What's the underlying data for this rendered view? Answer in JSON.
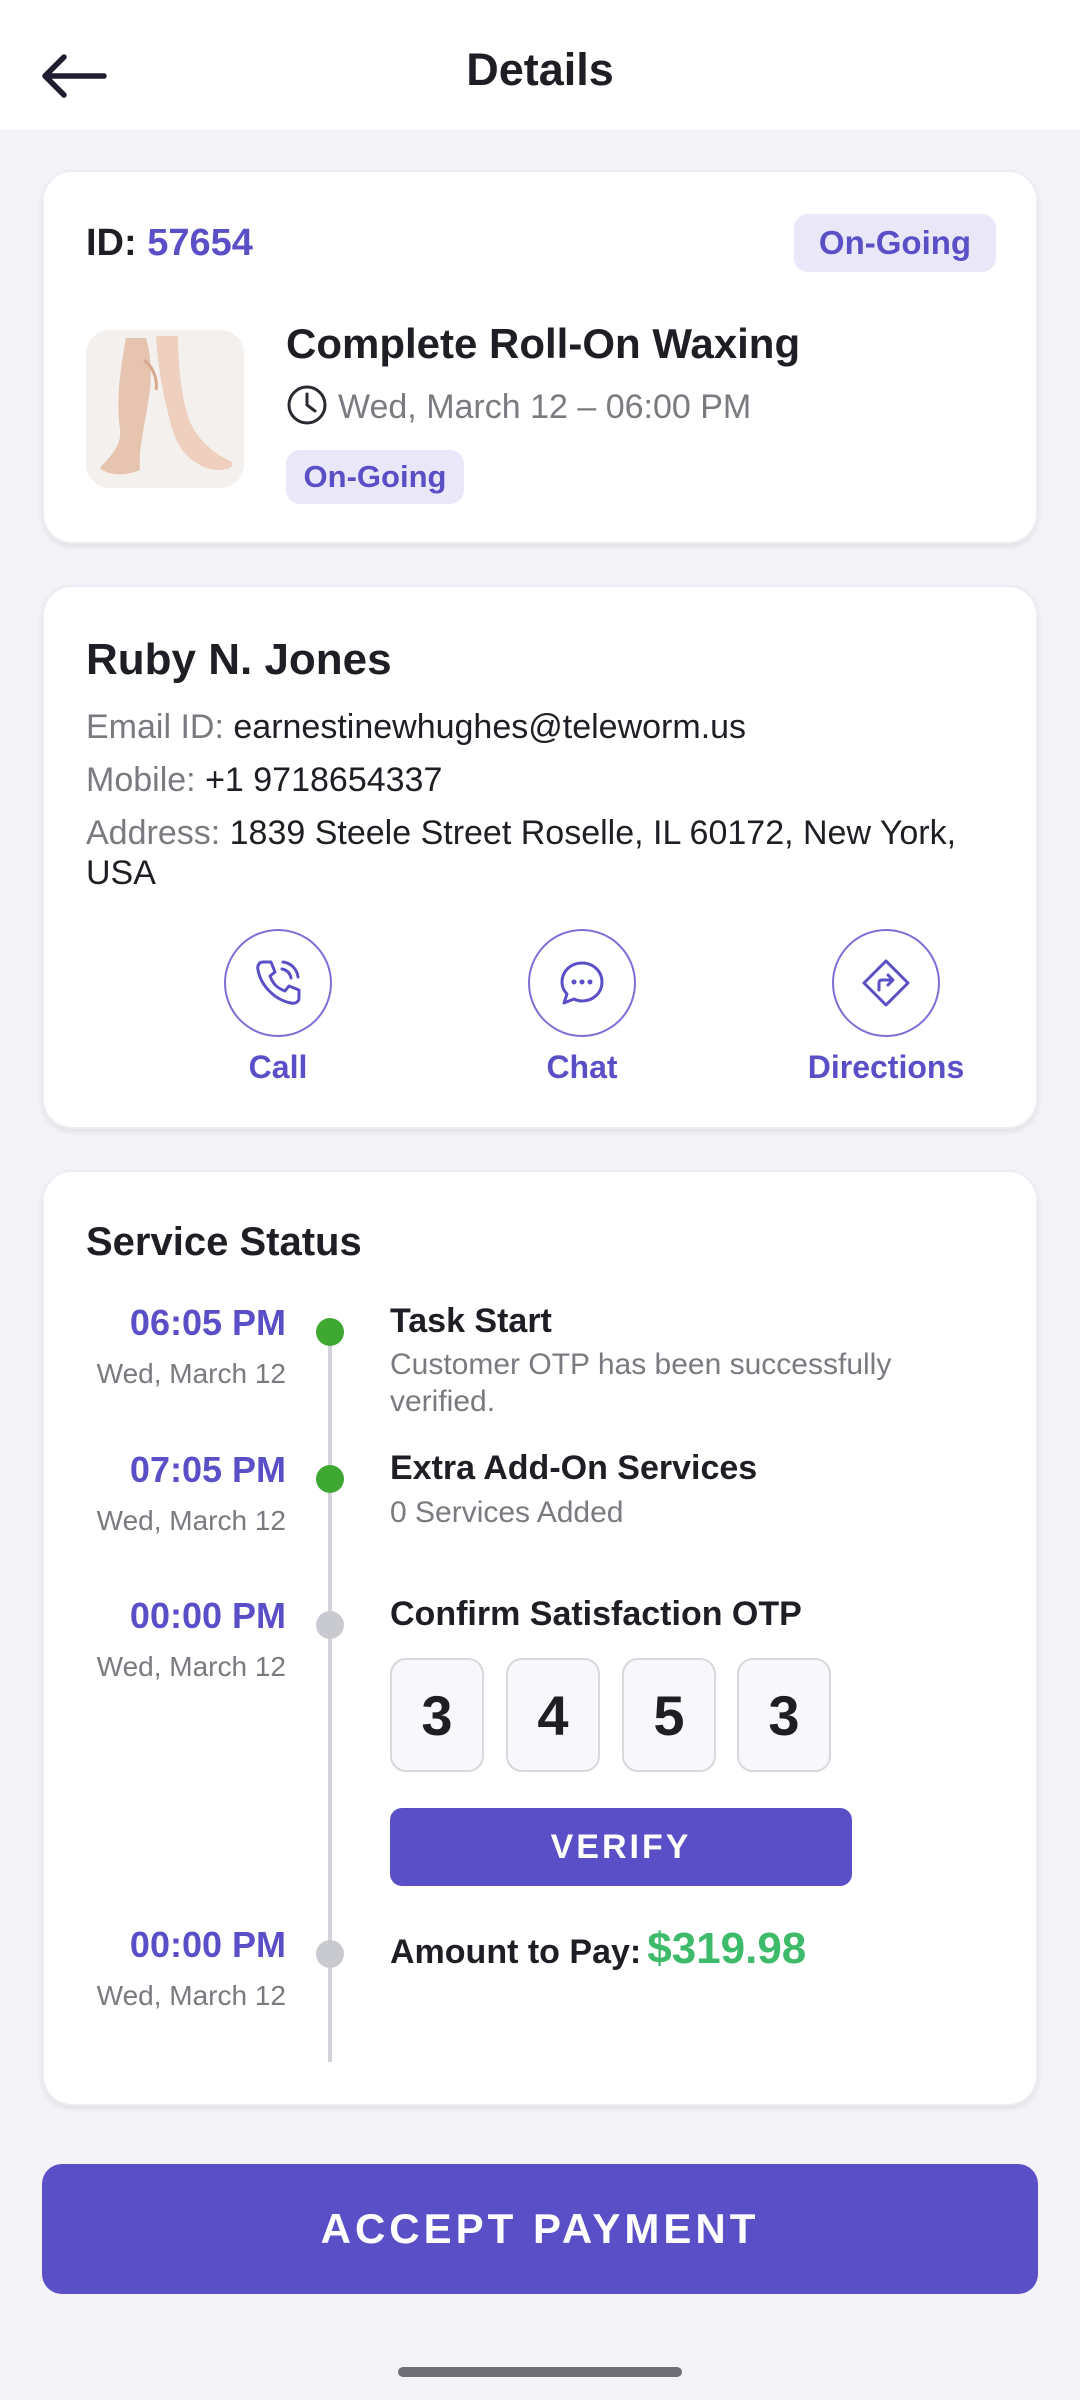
{
  "header": {
    "title": "Details"
  },
  "booking": {
    "id_label": "ID:",
    "id_value": "57654",
    "status_badge": "On-Going",
    "service_name": "Complete Roll-On Waxing",
    "datetime": "Wed, March 12 – 06:00 PM",
    "service_status": "On-Going"
  },
  "customer": {
    "name": "Ruby N. Jones",
    "email_label": "Email ID:",
    "email": "earnestinewhughes@teleworm.us",
    "mobile_label": "Mobile:",
    "mobile": "+1 9718654337",
    "address_label": "Address:",
    "address": "1839 Steele Street Roselle, IL 60172, New York, USA",
    "actions": [
      {
        "label": "Call",
        "icon": "phone-icon"
      },
      {
        "label": "Chat",
        "icon": "chat-icon"
      },
      {
        "label": "Directions",
        "icon": "directions-icon"
      }
    ]
  },
  "service_status": {
    "title": "Service Status",
    "steps": [
      {
        "time": "06:05 PM",
        "date": "Wed, March 12",
        "title": "Task Start",
        "subtitle": "Customer OTP has been successfully verified.",
        "state": "done"
      },
      {
        "time": "07:05 PM",
        "date": "Wed, March 12",
        "title": "Extra Add-On Services",
        "subtitle": "0 Services Added",
        "state": "done"
      },
      {
        "time": "00:00 PM",
        "date": "Wed, March 12",
        "title": "Confirm Satisfaction OTP",
        "state": "pending"
      },
      {
        "time": "00:00 PM",
        "date": "Wed, March 12",
        "title": "Amount to Pay:",
        "state": "pending"
      }
    ],
    "otp_digits": [
      "3",
      "4",
      "5",
      "3"
    ],
    "verify_label": "VERIFY",
    "amount": "$319.98"
  },
  "accept_label": "ACCEPT PAYMENT",
  "colors": {
    "accent": "#5b4fc7",
    "done": "#3fa833",
    "pending": "#c9c9d0",
    "amount": "#3dbb6a"
  }
}
